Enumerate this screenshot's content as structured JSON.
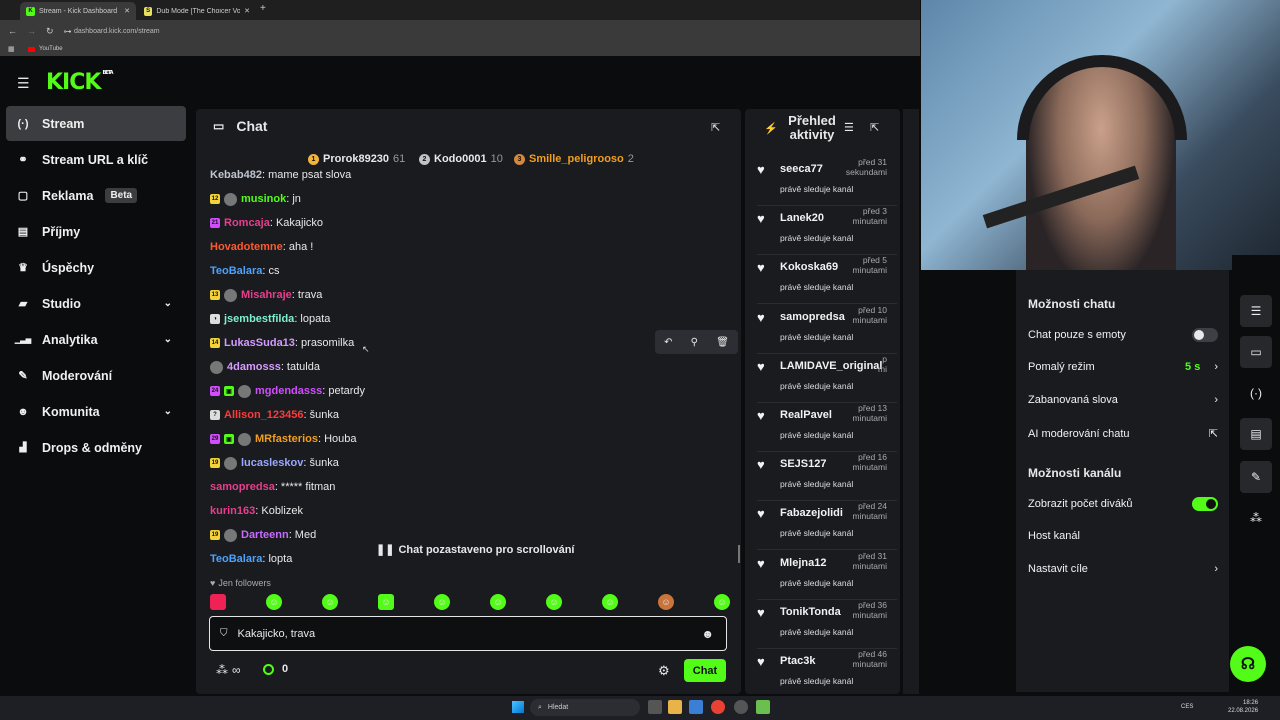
{
  "browser": {
    "tabs": [
      {
        "title": "Stream - Kick Dashboard",
        "fav": "K",
        "fav_color": "#53fc18"
      },
      {
        "title": "Dub Mode [The Choicer Voices]",
        "fav": "S",
        "fav_color": "#e8e060"
      }
    ],
    "url": "dashboard.kick.com/stream",
    "bookmark": "YouTube"
  },
  "app": {
    "logo": "KICK",
    "logo_beta": "BETA"
  },
  "sidebar": {
    "items": [
      {
        "label": "Stream",
        "icon": "broadcast-icon",
        "glyph": "(·)"
      },
      {
        "label": "Stream URL a klíč",
        "icon": "link-icon",
        "glyph": "⚭"
      },
      {
        "label": "Reklama",
        "icon": "ad-icon",
        "glyph": "▢",
        "badge": "Beta"
      },
      {
        "label": "Příjmy",
        "icon": "wallet-icon",
        "glyph": "▤"
      },
      {
        "label": "Úspěchy",
        "icon": "trophy-icon",
        "glyph": "♛"
      },
      {
        "label": "Studio",
        "icon": "studio-icon",
        "glyph": "▰",
        "chevron": true
      },
      {
        "label": "Analytika",
        "icon": "analytics-icon",
        "glyph": "▁▃▅",
        "chevron": true
      },
      {
        "label": "Moderování",
        "icon": "wrench-icon",
        "glyph": "✎"
      },
      {
        "label": "Komunita",
        "icon": "community-icon",
        "glyph": "☻",
        "chevron": true
      },
      {
        "label": "Drops & odměny",
        "icon": "drops-icon",
        "glyph": "▟"
      }
    ]
  },
  "chat": {
    "title": "Chat",
    "top": [
      {
        "rank": "1",
        "name": "Prorok89230",
        "count": "61",
        "color": "#f2b53a"
      },
      {
        "rank": "2",
        "name": "Kodo0001",
        "count": "10",
        "color": "#bfc3c8"
      },
      {
        "rank": "3",
        "name": "Smille_peligrooso",
        "count": "2",
        "color": "#d6873b"
      }
    ],
    "messages": [
      {
        "user": "Kebab482",
        "text": ": mame psat slova",
        "color": "#bfc6d0",
        "badges": []
      },
      {
        "user": "musinok",
        "text": ": jn",
        "color": "#53fc18",
        "badges": [
          "12",
          "av"
        ]
      },
      {
        "user": "Romcaja",
        "text": ": Kakajicko",
        "color": "#e83e8c",
        "badges": [
          "21"
        ]
      },
      {
        "user": "Hovadotemne",
        "text": ": aha !",
        "color": "#ff5a2d",
        "badges": []
      },
      {
        "user": "TeoBalara",
        "text": ": cs",
        "color": "#4aa3ff",
        "badges": []
      },
      {
        "user": "Misahraje",
        "text": ": trava",
        "color": "#e83e8c",
        "badges": [
          "13",
          "av"
        ]
      },
      {
        "user": "jsembestfilda",
        "text": ": lopata",
        "color": "#7ef0d0",
        "badges": [
          "◑"
        ]
      },
      {
        "user": "LukasSuda13",
        "text": ": prasomilka",
        "color": "#d59bff",
        "badges": [
          "14"
        ]
      },
      {
        "user": "4damosss",
        "text": ": tatulda",
        "color": "#d59bff",
        "badges": [
          "av"
        ]
      },
      {
        "user": "mgdendasss",
        "text": ": petardy",
        "color": "#d14eff",
        "badges": [
          "24",
          "gift",
          "av"
        ]
      },
      {
        "user": "Allison_123456",
        "text": ": šunka",
        "color": "#ff3a3a",
        "badges": [
          "?"
        ]
      },
      {
        "user": "MRfasterios",
        "text": ": Houba",
        "color": "#f29e1f",
        "badges": [
          "29",
          "gift",
          "av"
        ]
      },
      {
        "user": "lucasleskov",
        "text": ": šunka",
        "color": "#9aa7ff",
        "badges": [
          "19",
          "av"
        ]
      },
      {
        "user": "samopredsa",
        "text": ": ***** fitman",
        "color": "#e83e8c",
        "badges": []
      },
      {
        "user": "kurin163",
        "text": ": Koblizek",
        "color": "#e83e8c",
        "badges": []
      },
      {
        "user": "Darteenn",
        "text": ": Med",
        "color": "#c66bff",
        "badges": [
          "19",
          "av"
        ]
      },
      {
        "user": "TeoBalara",
        "text": ": lopta",
        "color": "#4aa3ff",
        "badges": []
      }
    ],
    "paused": "Chat pozastaveno pro scrollování",
    "followers_only": "Jen followers",
    "input_value": "Kakajicko, trava",
    "points": "0",
    "send_label": "Chat"
  },
  "activity": {
    "title": "Přehled aktivity",
    "items": [
      {
        "name": "seeca77",
        "time1": "před 31",
        "time2": "sekundami",
        "sub": "právě sleduje kanál"
      },
      {
        "name": "Lanek20",
        "time1": "před 3",
        "time2": "minutami",
        "sub": "právě sleduje kanál"
      },
      {
        "name": "Kokoska69",
        "time1": "před 5",
        "time2": "minutami",
        "sub": "právě sleduje kanál"
      },
      {
        "name": "samopredsa",
        "time1": "před 10",
        "time2": "minutami",
        "sub": "právě sleduje kanál"
      },
      {
        "name": "LAMIDAVE_original",
        "time1": "p",
        "time2": "mi",
        "sub": "právě sleduje kanál"
      },
      {
        "name": "RealPavel",
        "time1": "před 13",
        "time2": "minutami",
        "sub": "právě sleduje kanál"
      },
      {
        "name": "SEJS127",
        "time1": "před 16",
        "time2": "minutami",
        "sub": "právě sleduje kanál"
      },
      {
        "name": "Fabazejolidi",
        "time1": "před 24",
        "time2": "minutami",
        "sub": "právě sleduje kanál"
      },
      {
        "name": "Mlejna12",
        "time1": "před 31",
        "time2": "minutami",
        "sub": "právě sleduje kanál"
      },
      {
        "name": "TonikTonda",
        "time1": "před 36",
        "time2": "minutami",
        "sub": "právě sleduje kanál"
      },
      {
        "name": "Ptac3k",
        "time1": "před 46",
        "time2": "minutami",
        "sub": "právě sleduje kanál"
      }
    ]
  },
  "options": {
    "chat_heading": "Možnosti chatu",
    "emote_only": "Chat pouze s emoty",
    "slow_mode": "Pomalý režim",
    "slow_value": "5 s",
    "banned_words": "Zabanovaná slova",
    "ai_mod": "AI moderování chatu",
    "channel_heading": "Možnosti kanálu",
    "show_viewers": "Zobrazit počet diváků",
    "host": "Host kanál",
    "goals": "Nastavit cíle"
  },
  "taskbar": {
    "search": "Hledat",
    "lang": "CES",
    "time": "18:26",
    "date": "22.08.2026"
  },
  "colors": {
    "accent": "#53fc18",
    "panel": "#191b1f",
    "bg": "#0b0c0e"
  }
}
